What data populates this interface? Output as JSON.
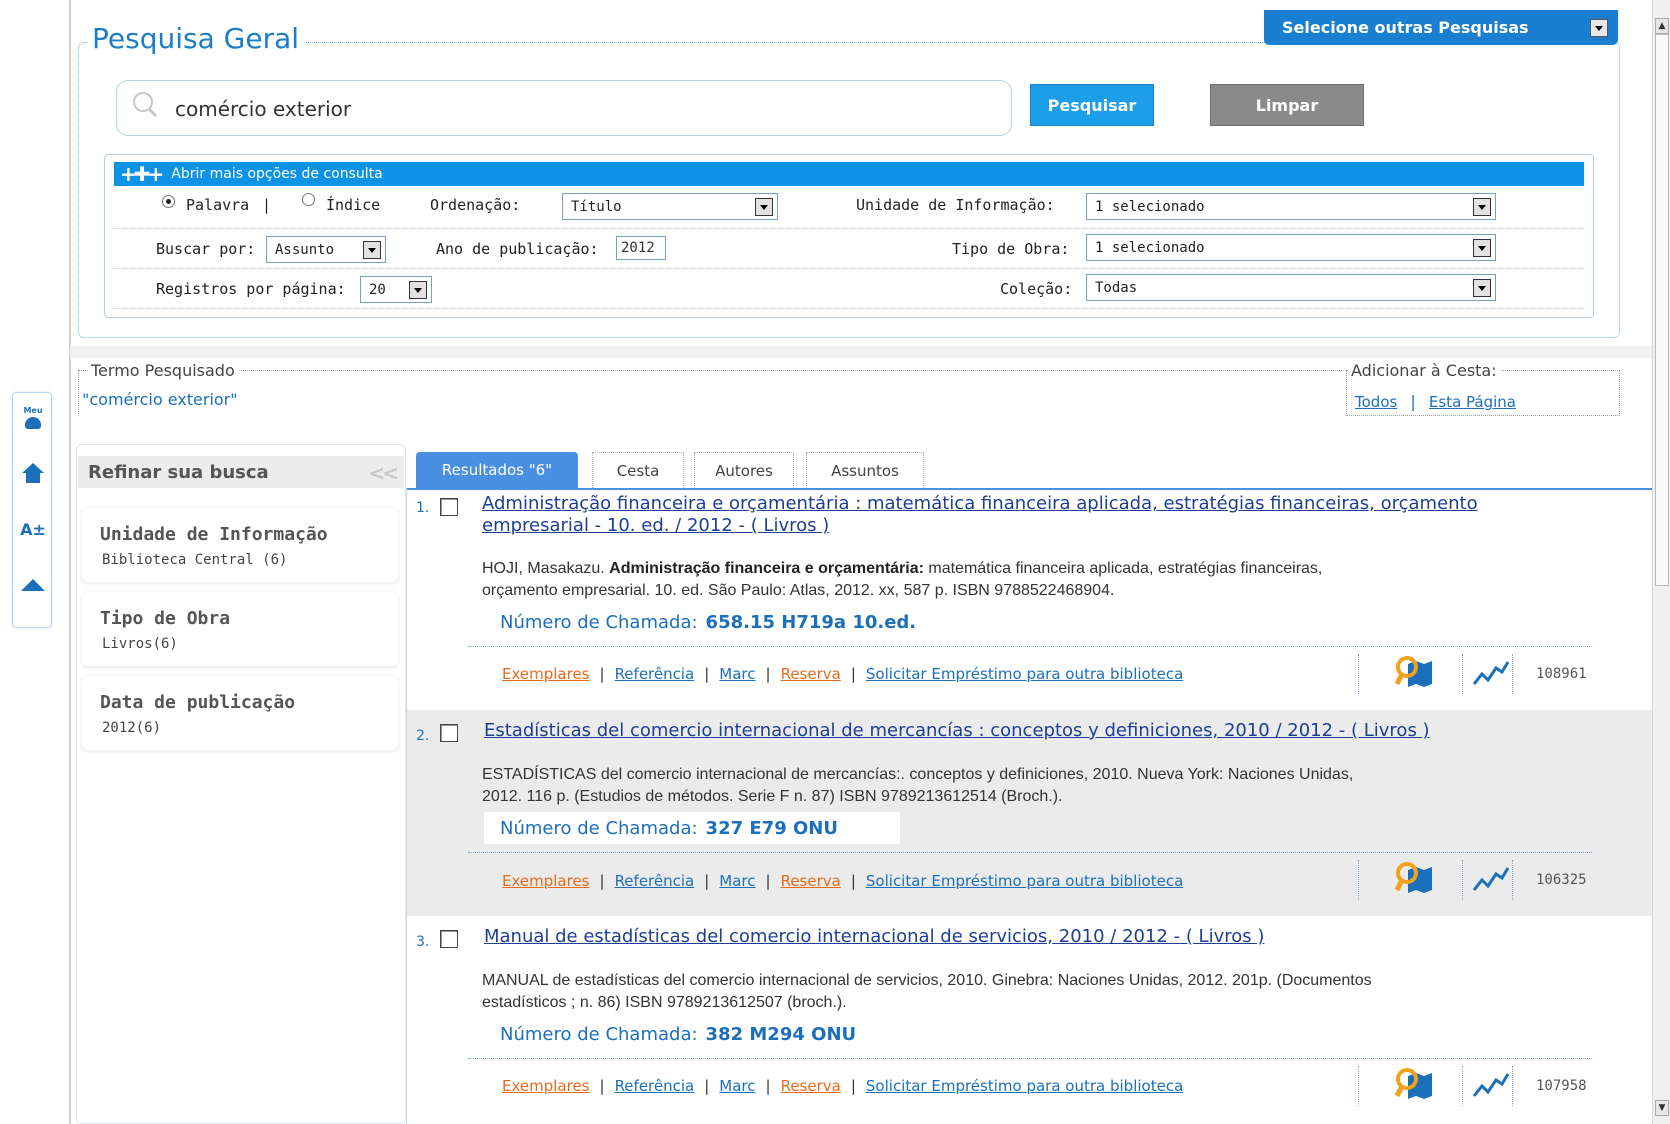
{
  "header": {
    "title": "Pesquisa Geral",
    "select_other": "Selecione outras Pesquisas"
  },
  "search": {
    "value": "comércio exterior",
    "search_button": "Pesquisar",
    "clear_button": "Limpar"
  },
  "options": {
    "toggle_label": "Abrir mais opções de consulta",
    "mode_word": "Palavra",
    "mode_sep": "|",
    "mode_index": "Índice",
    "ordering_label": "Ordenação:",
    "ordering_value": "Título",
    "unit_label": "Unidade de Informação:",
    "unit_value": "1 selecionado",
    "search_by_label": "Buscar por:",
    "search_by_value": "Assunto",
    "year_label": "Ano de publicação:",
    "year_value": "2012",
    "type_label": "Tipo de Obra:",
    "type_value": "1 selecionado",
    "per_page_label": "Registros por página:",
    "per_page_value": "20",
    "collection_label": "Coleção:",
    "collection_value": "Todas"
  },
  "term": {
    "legend": "Termo Pesquisado",
    "value": "\"comércio exterior\""
  },
  "basket": {
    "legend": "Adicionar à Cesta:",
    "all": "Todos",
    "sep": "|",
    "page": "Esta Página"
  },
  "side_tools": {
    "meu_label": "Meu"
  },
  "refine": {
    "title": "Refinar sua busca",
    "facets": [
      {
        "title": "Unidade de Informação",
        "value": "Biblioteca Central (6)"
      },
      {
        "title": "Tipo de Obra",
        "value": "Livros(6)"
      },
      {
        "title": "Data de publicação",
        "value": "2012(6)"
      }
    ]
  },
  "tabs": [
    "Resultados \"6\"",
    "Cesta",
    "Autores",
    "Assuntos"
  ],
  "actions": {
    "exemplares": "Exemplares",
    "referencia": "Referência",
    "marc": "Marc",
    "reserva": "Reserva",
    "solicitar": "Solicitar Empréstimo para outra biblioteca",
    "sep": "|",
    "call_label": "Número de Chamada:"
  },
  "results": [
    {
      "num": "1.",
      "title_line1": "Administração financeira e orçamentária : matemática financeira aplicada, estratégias financeiras, orçamento",
      "title_line2": "empresarial - 10. ed. / 2012 - ( Livros )",
      "body_prefix": "HOJI, Masakazu. ",
      "body_bold": "Administração financeira e orçamentária:",
      "body_rest1": " matemática financeira aplicada, estratégias financeiras,",
      "body_line2": "orçamento empresarial. 10. ed. São Paulo: Atlas, 2012. xx, 587 p. ISBN 9788522468904.",
      "call_number": "658.15 H719a 10.ed.",
      "id": "108961"
    },
    {
      "num": "2.",
      "title_line1": "Estadísticas del comercio internacional de mercancías : conceptos y definiciones, 2010 / 2012 - ( Livros )",
      "body_line1": "ESTADÍSTICAS del comercio internacional de mercancías:. conceptos y definiciones, 2010. Nueva York: Naciones Unidas,",
      "body_line2": "2012. 116 p. (Estudios de métodos. Serie F n. 87) ISBN 9789213612514 (Broch.).",
      "call_number": "327 E79 ONU",
      "id": "106325"
    },
    {
      "num": "3.",
      "title_line1": "Manual de estadísticas del comercio internacional de servicios, 2010 / 2012 - ( Livros )",
      "body_line1": "MANUAL de estadísticas del comercio internacional de servicios, 2010. Ginebra: Naciones Unidas, 2012. 201p. (Documentos",
      "body_line2": "estadísticos ; n. 86) ISBN 9789213612507 (broch.).",
      "call_number": "382 M294 ONU",
      "id": "107958"
    }
  ]
}
